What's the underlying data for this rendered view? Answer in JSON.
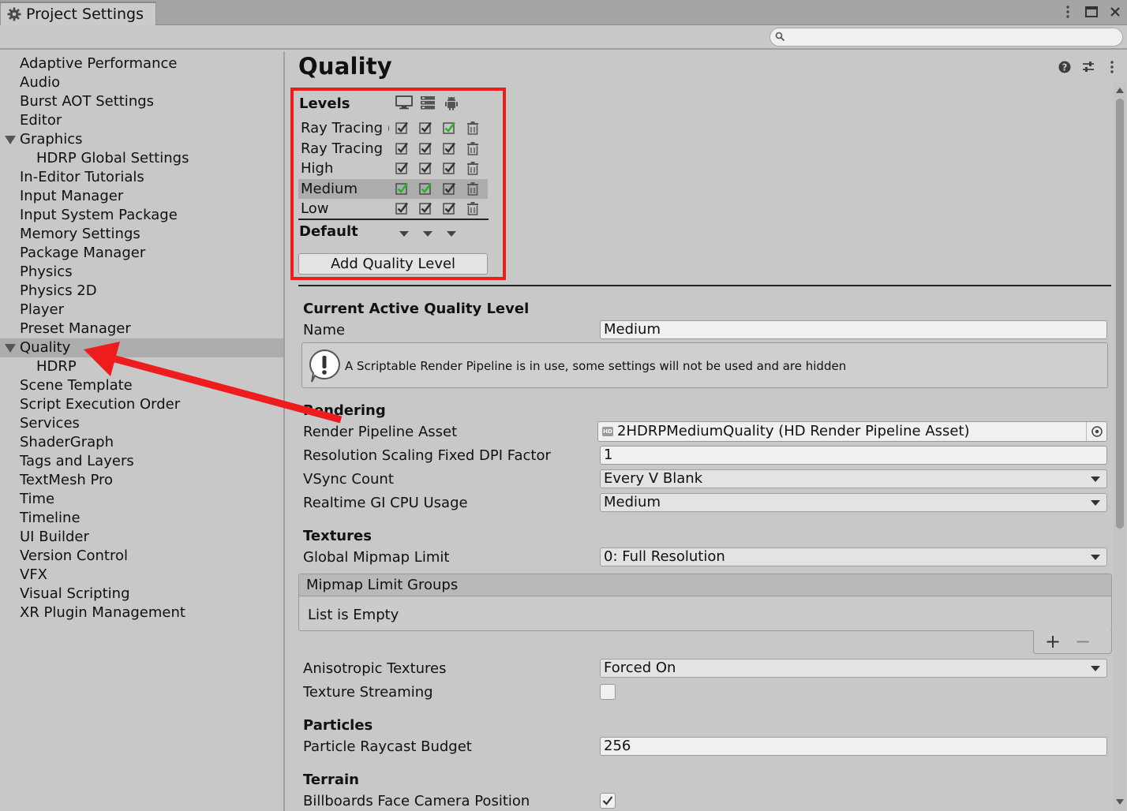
{
  "window": {
    "tab_title": "Project Settings",
    "search": {
      "value": "",
      "placeholder": ""
    }
  },
  "sidebar": {
    "items": [
      {
        "label": "Adaptive Performance"
      },
      {
        "label": "Audio"
      },
      {
        "label": "Burst AOT Settings"
      },
      {
        "label": "Editor"
      },
      {
        "label": "Graphics",
        "expanded": true
      },
      {
        "label": "HDRP Global Settings",
        "child": true
      },
      {
        "label": "In-Editor Tutorials"
      },
      {
        "label": "Input Manager"
      },
      {
        "label": "Input System Package"
      },
      {
        "label": "Memory Settings"
      },
      {
        "label": "Package Manager"
      },
      {
        "label": "Physics"
      },
      {
        "label": "Physics 2D"
      },
      {
        "label": "Player"
      },
      {
        "label": "Preset Manager"
      },
      {
        "label": "Quality",
        "expanded": true,
        "selected": true
      },
      {
        "label": "HDRP",
        "child": true
      },
      {
        "label": "Scene Template"
      },
      {
        "label": "Script Execution Order"
      },
      {
        "label": "Services"
      },
      {
        "label": "ShaderGraph"
      },
      {
        "label": "Tags and Layers"
      },
      {
        "label": "TextMesh Pro"
      },
      {
        "label": "Time"
      },
      {
        "label": "Timeline"
      },
      {
        "label": "UI Builder"
      },
      {
        "label": "Version Control"
      },
      {
        "label": "VFX"
      },
      {
        "label": "Visual Scripting"
      },
      {
        "label": "XR Plugin Management"
      }
    ]
  },
  "main": {
    "title": "Quality",
    "header_icons": [
      "help-icon",
      "preset-sliders-icon",
      "more-menu-icon"
    ],
    "levels": {
      "header": "Levels",
      "platforms": [
        "desktop-icon",
        "server-icon",
        "android-icon"
      ],
      "rows": [
        {
          "name": "Ray Tracing (",
          "checks": [
            true,
            true,
            true
          ],
          "default_for": [
            false,
            false,
            true
          ],
          "selected": false
        },
        {
          "name": "Ray Tracing",
          "checks": [
            true,
            true,
            true
          ],
          "default_for": [
            false,
            false,
            false
          ],
          "selected": false
        },
        {
          "name": "High",
          "checks": [
            true,
            true,
            true
          ],
          "default_for": [
            false,
            false,
            false
          ],
          "selected": false
        },
        {
          "name": "Medium",
          "checks": [
            true,
            true,
            true
          ],
          "default_for": [
            true,
            true,
            false
          ],
          "selected": true
        },
        {
          "name": "Low",
          "checks": [
            true,
            true,
            true
          ],
          "default_for": [
            false,
            false,
            false
          ],
          "selected": false
        }
      ],
      "default_label": "Default",
      "add_button": "Add Quality Level"
    },
    "current": {
      "section_title": "Current Active Quality Level",
      "name_label": "Name",
      "name_value": "Medium",
      "help_text": "A Scriptable Render Pipeline is in use, some settings will not be used and are hidden"
    },
    "rendering": {
      "section_title": "Rendering",
      "pipeline_label": "Render Pipeline Asset",
      "pipeline_value": "2HDRPMediumQuality (HD Render Pipeline Asset)",
      "dpi_label": "Resolution Scaling Fixed DPI Factor",
      "dpi_value": "1",
      "vsync_label": "VSync Count",
      "vsync_value": "Every V Blank",
      "gi_label": "Realtime GI CPU Usage",
      "gi_value": "Medium"
    },
    "textures": {
      "section_title": "Textures",
      "mipmap_label": "Global Mipmap Limit",
      "mipmap_value": "0: Full Resolution",
      "groups_header": "Mipmap Limit Groups",
      "groups_empty": "List is Empty",
      "add_symbol": "+",
      "remove_symbol": "−",
      "aniso_label": "Anisotropic Textures",
      "aniso_value": "Forced On",
      "streaming_label": "Texture Streaming",
      "streaming_checked": false
    },
    "particles": {
      "section_title": "Particles",
      "raycast_label": "Particle Raycast Budget",
      "raycast_value": "256"
    },
    "terrain": {
      "section_title": "Terrain",
      "billboards_label": "Billboards Face Camera Position",
      "billboards_checked": true
    }
  },
  "annotations": {
    "highlight_color": "#ee1c1c"
  },
  "colors": {
    "check_green": "#22b422",
    "selection": "#acacac"
  }
}
